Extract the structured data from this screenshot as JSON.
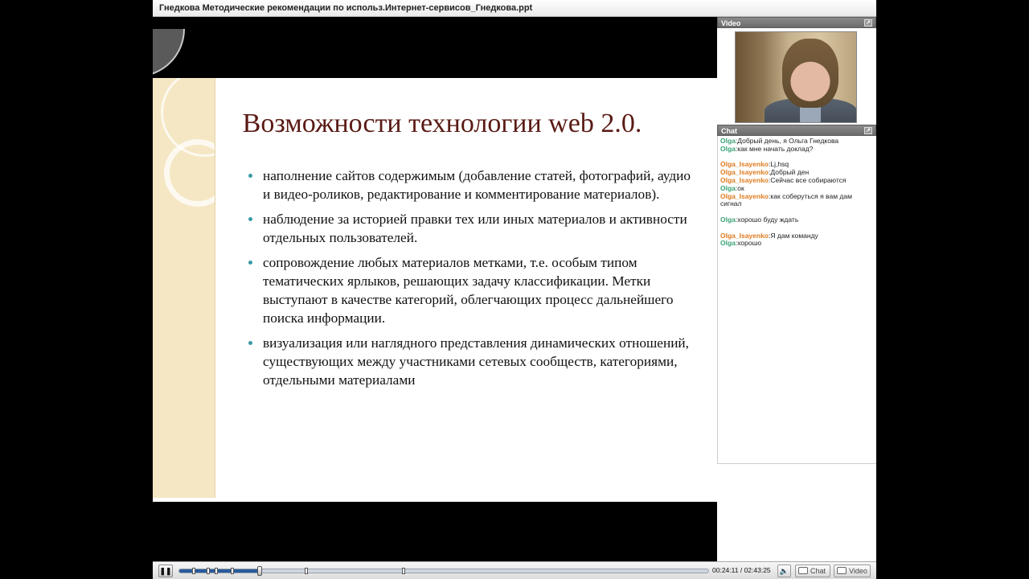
{
  "window": {
    "title": "Гнедкова Методические рекомендации по использ.Интернет-сервисов_Гнедкова.ppt"
  },
  "slide": {
    "title": "Возможности технологии web 2.0.",
    "bullets": [
      "наполнение сайтов содержимым (добавление статей, фотографий, аудио и видео-роликов, редактирование и комментирование материалов).",
      "наблюдение за историей правки тех или иных материалов и активности отдельных пользователей.",
      "сопровождение любых материалов метками, т.е. особым типом тематических ярлыков, решающих задачу классификации. Метки выступают в качестве категорий, облегчающих процесс дальнейшего поиска информации.",
      "визуализация или наглядного представления   динамических отношений, существующих между участниками сетевых сообществ, категориями, отдельными материалами"
    ]
  },
  "video_panel": {
    "label": "Video",
    "icon": "expand-icon"
  },
  "chat_panel": {
    "label": "Chat",
    "icon": "expand-icon",
    "messages": [
      {
        "user": "Olga",
        "text": "Добрый день, я Ольга Гнедкова"
      },
      {
        "user": "Olga",
        "text": "как мне начать доклад?"
      },
      {
        "user": "Olga_Isayenko",
        "text": "Lj,hsq"
      },
      {
        "user": "Olga_Isayenko",
        "text": "Добрый ден"
      },
      {
        "user": "Olga_Isayenko",
        "text": "Сейчас все собираются"
      },
      {
        "user": "Olga",
        "text": "ок"
      },
      {
        "user": "Olga_Isayenko",
        "text": "как соберуться я вам дам сигнал"
      },
      {
        "user": "Olga",
        "text": "хорошо буду ждать"
      },
      {
        "user": "Olga_Isayenko",
        "text": "Я дам команду"
      },
      {
        "user": "Olga",
        "text": "хорошо"
      }
    ]
  },
  "controls": {
    "play_icon": "pause-icon",
    "progress": 0.1519,
    "current_time": "00:24:11",
    "total_time": "02:43:25",
    "time_separator": " / ",
    "volume_icon": "speaker-icon",
    "chat_button": "Chat",
    "video_button": "Video"
  },
  "colors": {
    "title_color": "#5a1a14",
    "bullet_dot": "#3a9aa6",
    "user_olga": "#3aa374",
    "user_isayenko": "#e07b1f",
    "seek_fill": "#2a5a9b"
  }
}
